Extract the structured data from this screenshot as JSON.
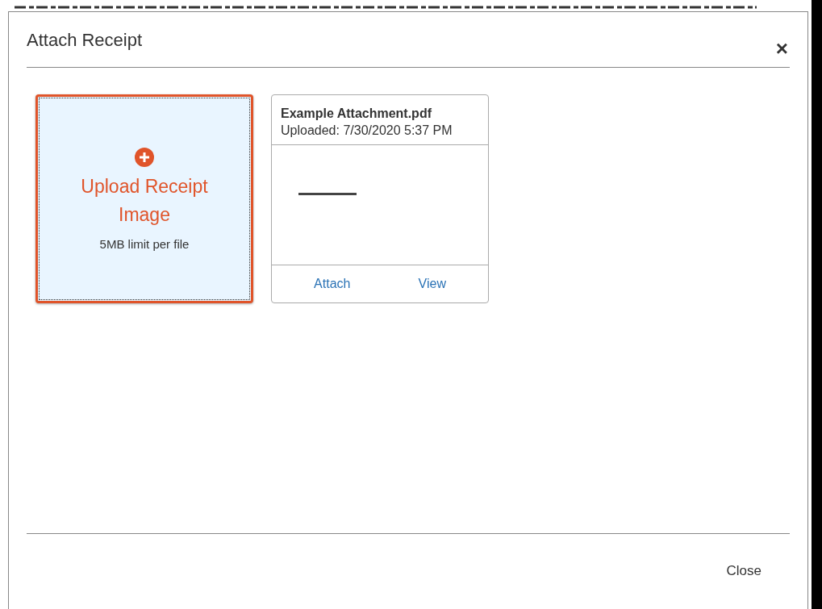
{
  "dialog": {
    "title": "Attach Receipt",
    "close_icon": "×"
  },
  "upload": {
    "label": "Upload Receipt Image",
    "limit": "5MB limit per file"
  },
  "attachments": [
    {
      "name": "Example Attachment.pdf",
      "uploaded": "Uploaded: 7/30/2020 5:37 PM",
      "actions": [
        "Attach",
        "View"
      ]
    }
  ],
  "footer": {
    "button": "Close"
  }
}
